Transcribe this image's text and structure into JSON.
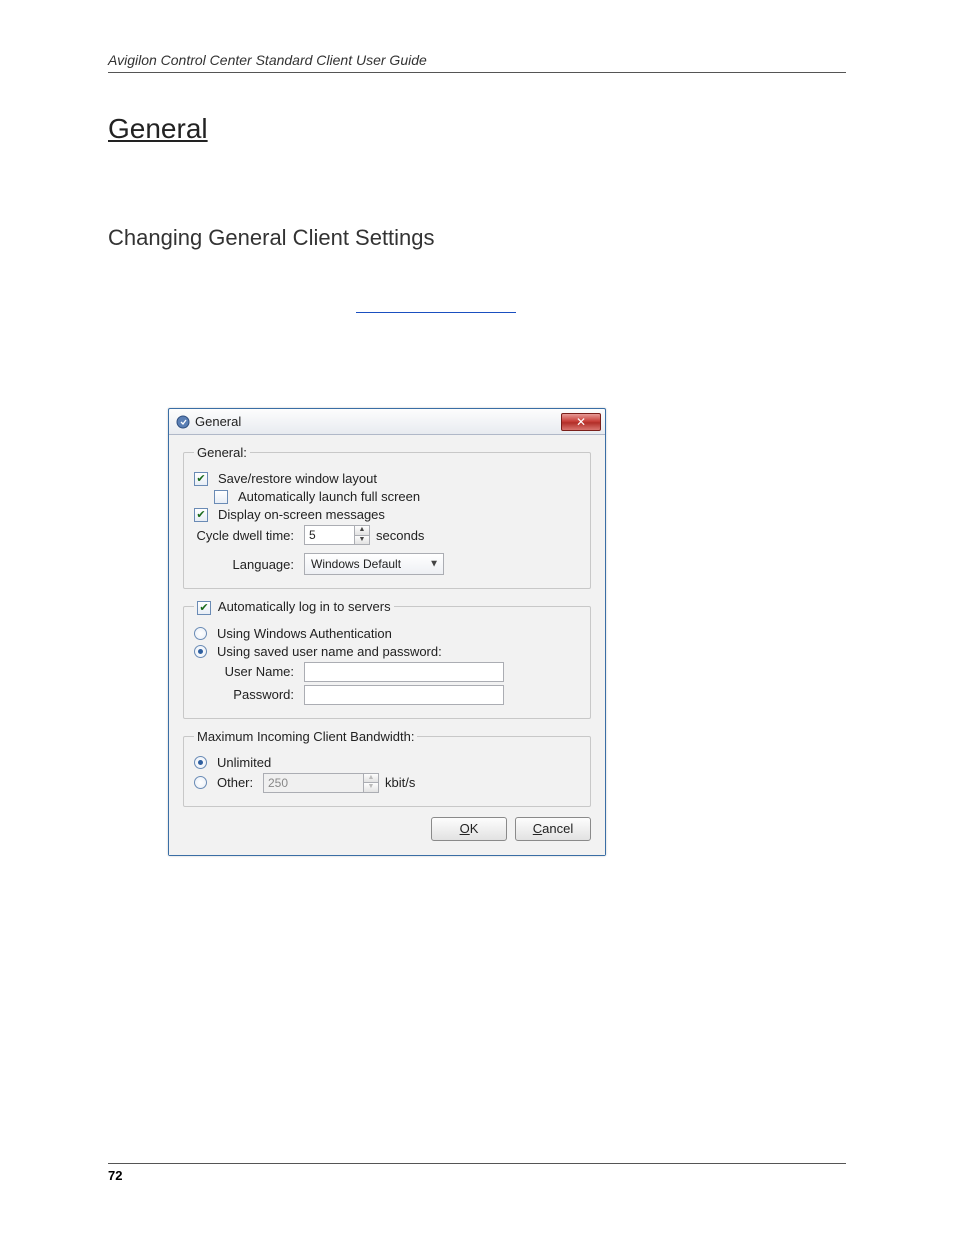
{
  "header": "Avigilon Control Center Standard Client User Guide",
  "section_title": "General",
  "sub_title": "Changing General Client Settings",
  "page_number": "72",
  "dialog": {
    "title": "General",
    "close_glyph": "✕",
    "group_general": {
      "legend": "General:",
      "save_restore": "Save/restore window layout",
      "auto_full": "Automatically launch full screen",
      "display_msgs": "Display on-screen messages",
      "dwell_label": "Cycle dwell time:",
      "dwell_value": "5",
      "dwell_unit": "seconds",
      "language_label": "Language:",
      "language_value": "Windows Default"
    },
    "group_login": {
      "legend": "Automatically log in to servers",
      "opt_windows": "Using Windows Authentication",
      "opt_saved": "Using saved user name and password:",
      "user_label": "User Name:",
      "user_value": "",
      "pass_label": "Password:",
      "pass_value": ""
    },
    "group_bw": {
      "legend": "Maximum Incoming Client Bandwidth:",
      "opt_unlimited": "Unlimited",
      "opt_other": "Other:",
      "other_value": "250",
      "other_unit": "kbit/s"
    },
    "buttons": {
      "ok_u": "O",
      "ok_rest": "K",
      "cancel_u": "C",
      "cancel_rest": "ancel"
    }
  }
}
